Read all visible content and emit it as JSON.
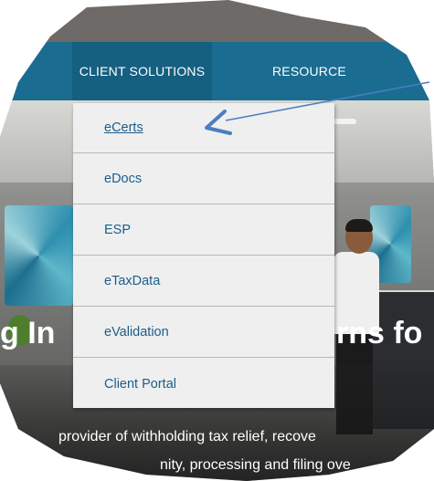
{
  "nav": {
    "client_solutions": "CLIENT SOLUTIONS",
    "resources": "RESOURCE"
  },
  "dropdown": {
    "items": [
      "eCerts",
      "eDocs",
      "ESP",
      "eTaxData",
      "eValidation",
      "Client Portal"
    ]
  },
  "hero": {
    "title_left": "g In",
    "title_right": "rns fo",
    "subtitle_line1": "provider of withholding tax relief, recove",
    "subtitle_line2": "nity, processing and filing ove"
  },
  "annotation": {
    "arrow_color": "#4a7fc1"
  },
  "colors": {
    "navbar": "#1a6c91",
    "dropdown_text": "#1a5e8a"
  }
}
